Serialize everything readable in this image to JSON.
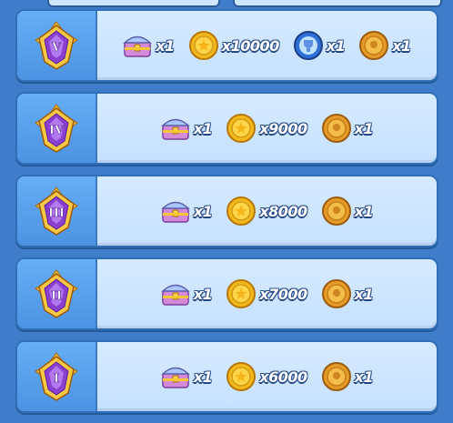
{
  "tiers": [
    {
      "rank_numeral": "V",
      "rewards": [
        {
          "icon": "treasure-chest-icon",
          "qty": "x1"
        },
        {
          "icon": "gold-coin-icon",
          "qty": "x10000"
        },
        {
          "icon": "blue-trophy-token-icon",
          "qty": "x1"
        },
        {
          "icon": "bronze-medal-token-icon",
          "qty": "x1"
        }
      ]
    },
    {
      "rank_numeral": "IV",
      "rewards": [
        {
          "icon": "treasure-chest-icon",
          "qty": "x1"
        },
        {
          "icon": "gold-coin-icon",
          "qty": "x9000"
        },
        {
          "icon": "bronze-medal-token-icon",
          "qty": "x1"
        }
      ]
    },
    {
      "rank_numeral": "III",
      "rewards": [
        {
          "icon": "treasure-chest-icon",
          "qty": "x1"
        },
        {
          "icon": "gold-coin-icon",
          "qty": "x8000"
        },
        {
          "icon": "bronze-medal-token-icon",
          "qty": "x1"
        }
      ]
    },
    {
      "rank_numeral": "II",
      "rewards": [
        {
          "icon": "treasure-chest-icon",
          "qty": "x1"
        },
        {
          "icon": "gold-coin-icon",
          "qty": "x7000"
        },
        {
          "icon": "bronze-medal-token-icon",
          "qty": "x1"
        }
      ]
    },
    {
      "rank_numeral": "I",
      "rewards": [
        {
          "icon": "treasure-chest-icon",
          "qty": "x1"
        },
        {
          "icon": "gold-coin-icon",
          "qty": "x6000"
        },
        {
          "icon": "bronze-medal-token-icon",
          "qty": "x1"
        }
      ]
    }
  ],
  "colors": {
    "background": "#3f7cc9",
    "row_fill": "#cfe5ff",
    "badge_fill": "#5aa2ef",
    "coin_gold": "#f2b81c",
    "emblem_purple": "#8a3fd1"
  }
}
